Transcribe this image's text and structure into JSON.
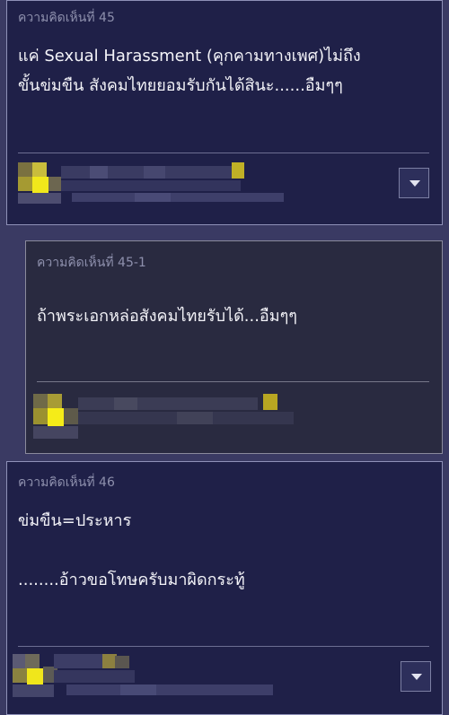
{
  "comments": [
    {
      "title": "ความคิดเห็นที่ 45",
      "body": "แค่ Sexual Harassment (คุกคามทางเพศ)ไม่ถึง\nขั้นข่มขืน สังคมไทยยอมรับกันได้สินะ......อืมๆๆ"
    },
    {
      "title": "ความคิดเห็นที่ 45-1",
      "body": "ถ้าพระเอกหล่อสังคมไทยรับได้...อืมๆๆ"
    },
    {
      "title": "ความคิดเห็นที่ 46",
      "body": "ข่มขืน=ประหาร\n\n........อ้าวขอโทษครับมาผิดกระทู้"
    }
  ],
  "icons": {
    "menu": "chevron-down-icon",
    "avatar": "pixelated-avatar"
  },
  "colors": {
    "background": "#3a3a63",
    "card": "#1f2048",
    "reply_card": "#292a40",
    "avatar_accent": "#e8df1a"
  }
}
